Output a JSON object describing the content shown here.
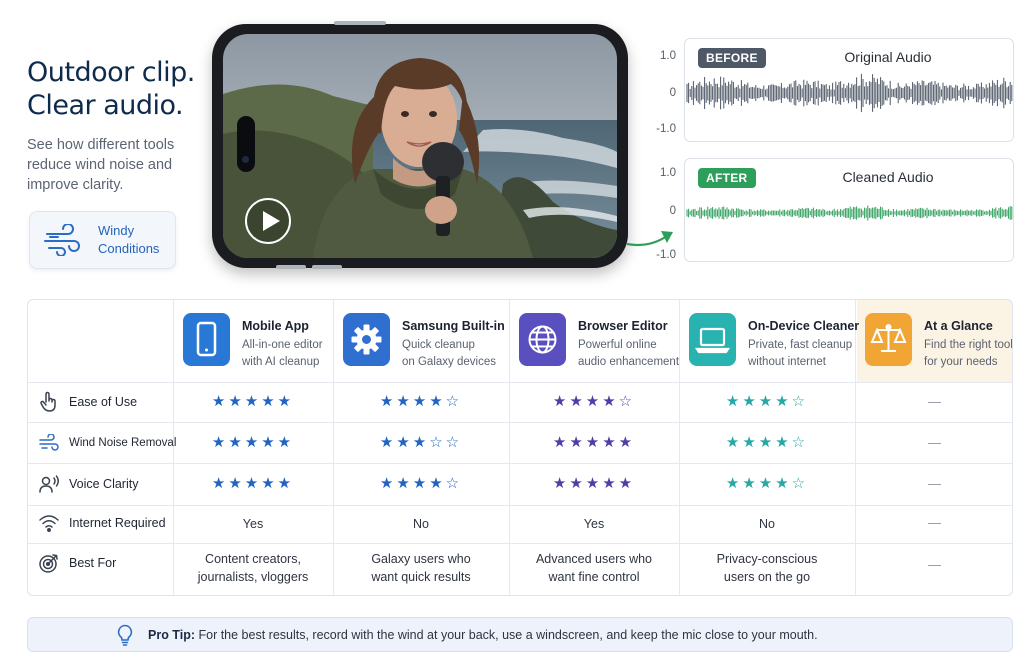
{
  "hero": {
    "title_line1": "Outdoor clip.",
    "title_line2": "Clear audio.",
    "subtitle": "See how different tools reduce wind noise and improve clarity.",
    "condition_line1": "Windy",
    "condition_line2": "Conditions",
    "condition_icon": "wind-icon"
  },
  "audio": {
    "axis_top": "1.0",
    "axis_mid": "0",
    "axis_bottom": "-1.0",
    "before_badge": "BEFORE",
    "before_title": "Original Audio",
    "after_badge": "AFTER",
    "after_title": "Cleaned Audio",
    "before_color": "#4e5866",
    "after_color": "#2e9e5b"
  },
  "tools": [
    {
      "name": "Mobile App",
      "desc_line1": "All-in-one editor",
      "desc_line2": "with AI cleanup",
      "icon": "smartphone-icon",
      "color": "#2a78d6",
      "star_color": "#2164c4"
    },
    {
      "name": "Samsung Built-in",
      "desc_line1": "Quick cleanup",
      "desc_line2": "on Galaxy devices",
      "icon": "gear-icon",
      "color": "#2f6fd0",
      "star_color": "#2164c4"
    },
    {
      "name": "Browser Editor",
      "desc_line1": "Powerful online",
      "desc_line2": "audio enhancement",
      "icon": "globe-icon",
      "color": "#5a4fbf",
      "star_color": "#4b3fa8"
    },
    {
      "name": "On-Device Cleaner",
      "desc_line1": "Private, fast cleanup",
      "desc_line2": "without internet",
      "icon": "laptop-icon",
      "color": "#28b3b0",
      "star_color": "#26a8a6"
    },
    {
      "name": "At a Glance",
      "desc_line1": "Find the right tool",
      "desc_line2": "for your needs",
      "icon": "balance-scale-icon",
      "color": "#f1a534"
    }
  ],
  "rows": [
    {
      "label": "Ease of Use",
      "icon": "pointer-hand-icon",
      "ratings": [
        5,
        4,
        4,
        4
      ],
      "glance": "—"
    },
    {
      "label": "Wind Noise Removal",
      "icon": "wind-icon",
      "ratings": [
        5,
        3,
        5,
        4
      ],
      "glance": "—"
    },
    {
      "label": "Voice Clarity",
      "icon": "user-voice-icon",
      "ratings": [
        5,
        4,
        5,
        4
      ],
      "glance": "—"
    },
    {
      "label": "Internet Required",
      "icon": "wifi-icon",
      "values": [
        "Yes",
        "No",
        "Yes",
        "No"
      ],
      "glance": "—"
    },
    {
      "label": "Best For",
      "icon": "target-icon",
      "lines": [
        [
          "Content creators,",
          "journalists, vloggers"
        ],
        [
          "Galaxy users who",
          "want quick results"
        ],
        [
          "Advanced users who",
          "want fine control"
        ],
        [
          "Privacy-conscious",
          "users on the go"
        ]
      ],
      "glance": "—"
    }
  ],
  "tip": {
    "label": "Pro Tip:",
    "text": "For the best results, record with the wind at your back, use a windscreen, and keep the mic close to your mouth.",
    "icon": "lightbulb-icon"
  }
}
